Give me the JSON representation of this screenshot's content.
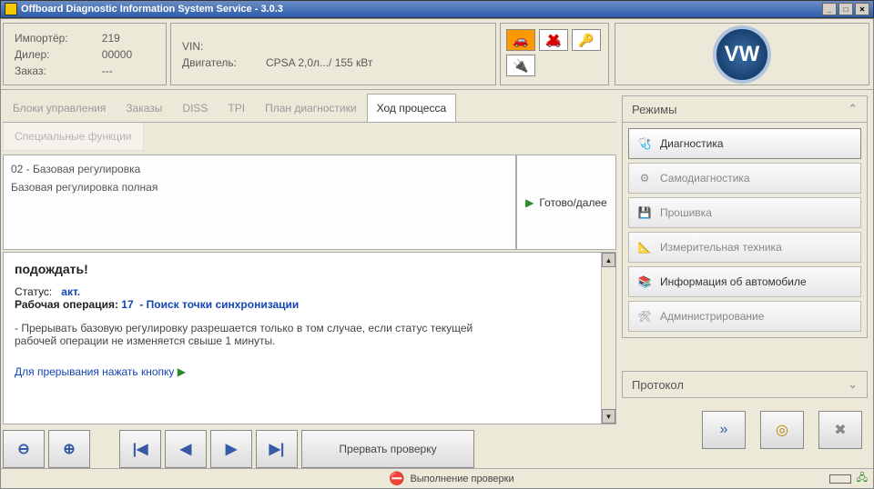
{
  "window": {
    "title": "Offboard Diagnostic Information System Service - 3.0.3"
  },
  "header": {
    "importer_lbl": "Импортёр:",
    "importer_val": "219",
    "dealer_lbl": "Дилер:",
    "dealer_val": "00000",
    "order_lbl": "Заказ:",
    "order_val": "---",
    "vin_lbl": "VIN:",
    "vin_val": "",
    "engine_lbl": "Двигатель:",
    "engine_val": "CPSA 2,0л.../ 155 кВт"
  },
  "tabs": {
    "items": [
      "Блоки управления",
      "Заказы",
      "DISS",
      "TPI",
      "План диагностики",
      "Ход процесса"
    ],
    "active_index": 5,
    "sub": "Специальные функции"
  },
  "status": {
    "code": "02 - Базовая регулировка",
    "desc": "Базовая регулировка полная",
    "ready": "Готово/далее"
  },
  "detail": {
    "wait": "подождать!",
    "status_lbl": "Статус:",
    "status_val": "акт.",
    "op_lbl": "Рабочая операция:",
    "op_num": "17",
    "op_txt": "- Поиск точки синхронизации",
    "note": "- Прерывать базовую регулировку разрешается только в том случае, если статус текущей рабочей операции не изменяется свыше 1 минуты.",
    "interrupt": "Для прерывания нажать кнопку",
    "interrupt_icon": "▶"
  },
  "toolbar": {
    "zoom_out": "⊖",
    "zoom_in": "⊕",
    "first": "|◀",
    "prev": "◀",
    "next": "▶",
    "last": "▶|",
    "abort": "Прервать проверку"
  },
  "modes": {
    "header": "Режимы",
    "items": [
      {
        "icon": "🩺",
        "label": "Диагностика",
        "active": true
      },
      {
        "icon": "⚙",
        "label": "Самодиагностика"
      },
      {
        "icon": "💾",
        "label": "Прошивка"
      },
      {
        "icon": "📐",
        "label": "Измерительная техника"
      },
      {
        "icon": "📚",
        "label": "Информация об автомобиле",
        "info": true
      },
      {
        "icon": "🛠",
        "label": "Администрирование"
      }
    ],
    "protocol": "Протокол"
  },
  "rightbtns": {
    "fwd": "»",
    "target": "◎",
    "cancel": "✖"
  },
  "statusbar": {
    "msg": "Выполнение проверки"
  }
}
